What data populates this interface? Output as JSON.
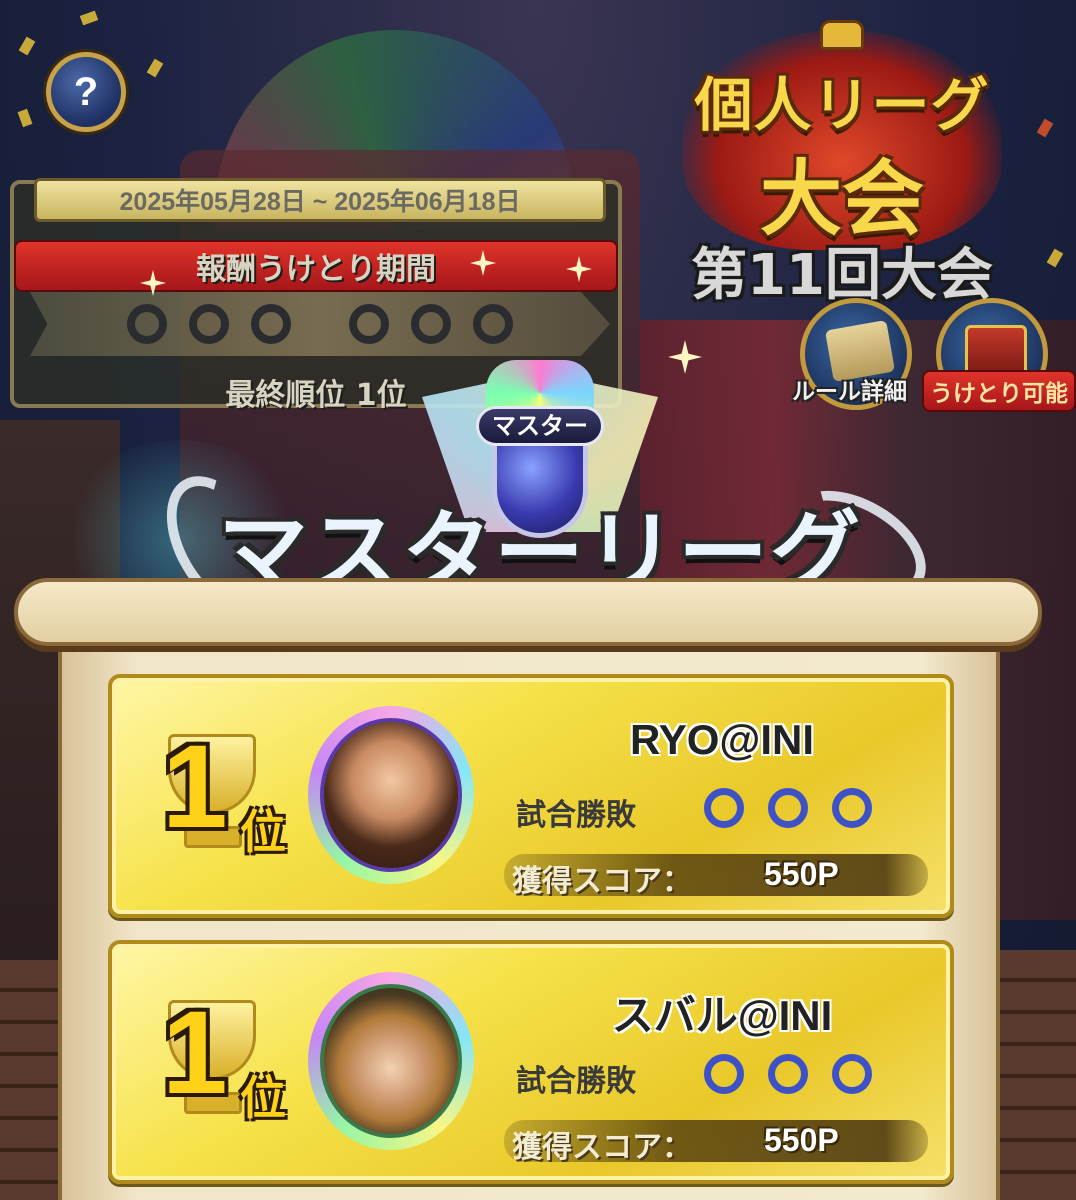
{
  "help_button": {
    "label": "?"
  },
  "period_panel": {
    "date_range": "2025年05月28日 ~ 2025年06月18日",
    "reward_period_label": "報酬うけとり期間",
    "final_rank_text": "最終順位 1位",
    "progress_rings": 6
  },
  "tournament": {
    "title_line1": "個人リーグ",
    "title_line2": "大会",
    "edition": "第11回大会"
  },
  "buttons": {
    "rules_label": "ルール詳細",
    "reward_label": "うけとり可能"
  },
  "league": {
    "badge_label": "マスター",
    "title": "マスターリーグ"
  },
  "rankings": [
    {
      "rank_number": "1",
      "rank_unit": "位",
      "player_name": "RYO@INI",
      "match_label": "試合勝敗",
      "results": [
        "win",
        "win",
        "win"
      ],
      "score_label": "獲得スコア：",
      "score_value": "550P"
    },
    {
      "rank_number": "1",
      "rank_unit": "位",
      "player_name": "スバル@INI",
      "match_label": "試合勝敗",
      "results": [
        "win",
        "win",
        "win"
      ],
      "score_label": "獲得スコア：",
      "score_value": "550P"
    }
  ],
  "colors": {
    "card_gold": "#f6e24a",
    "win_ring": "#3d52c6",
    "rank_gold": "#ffd21a"
  }
}
